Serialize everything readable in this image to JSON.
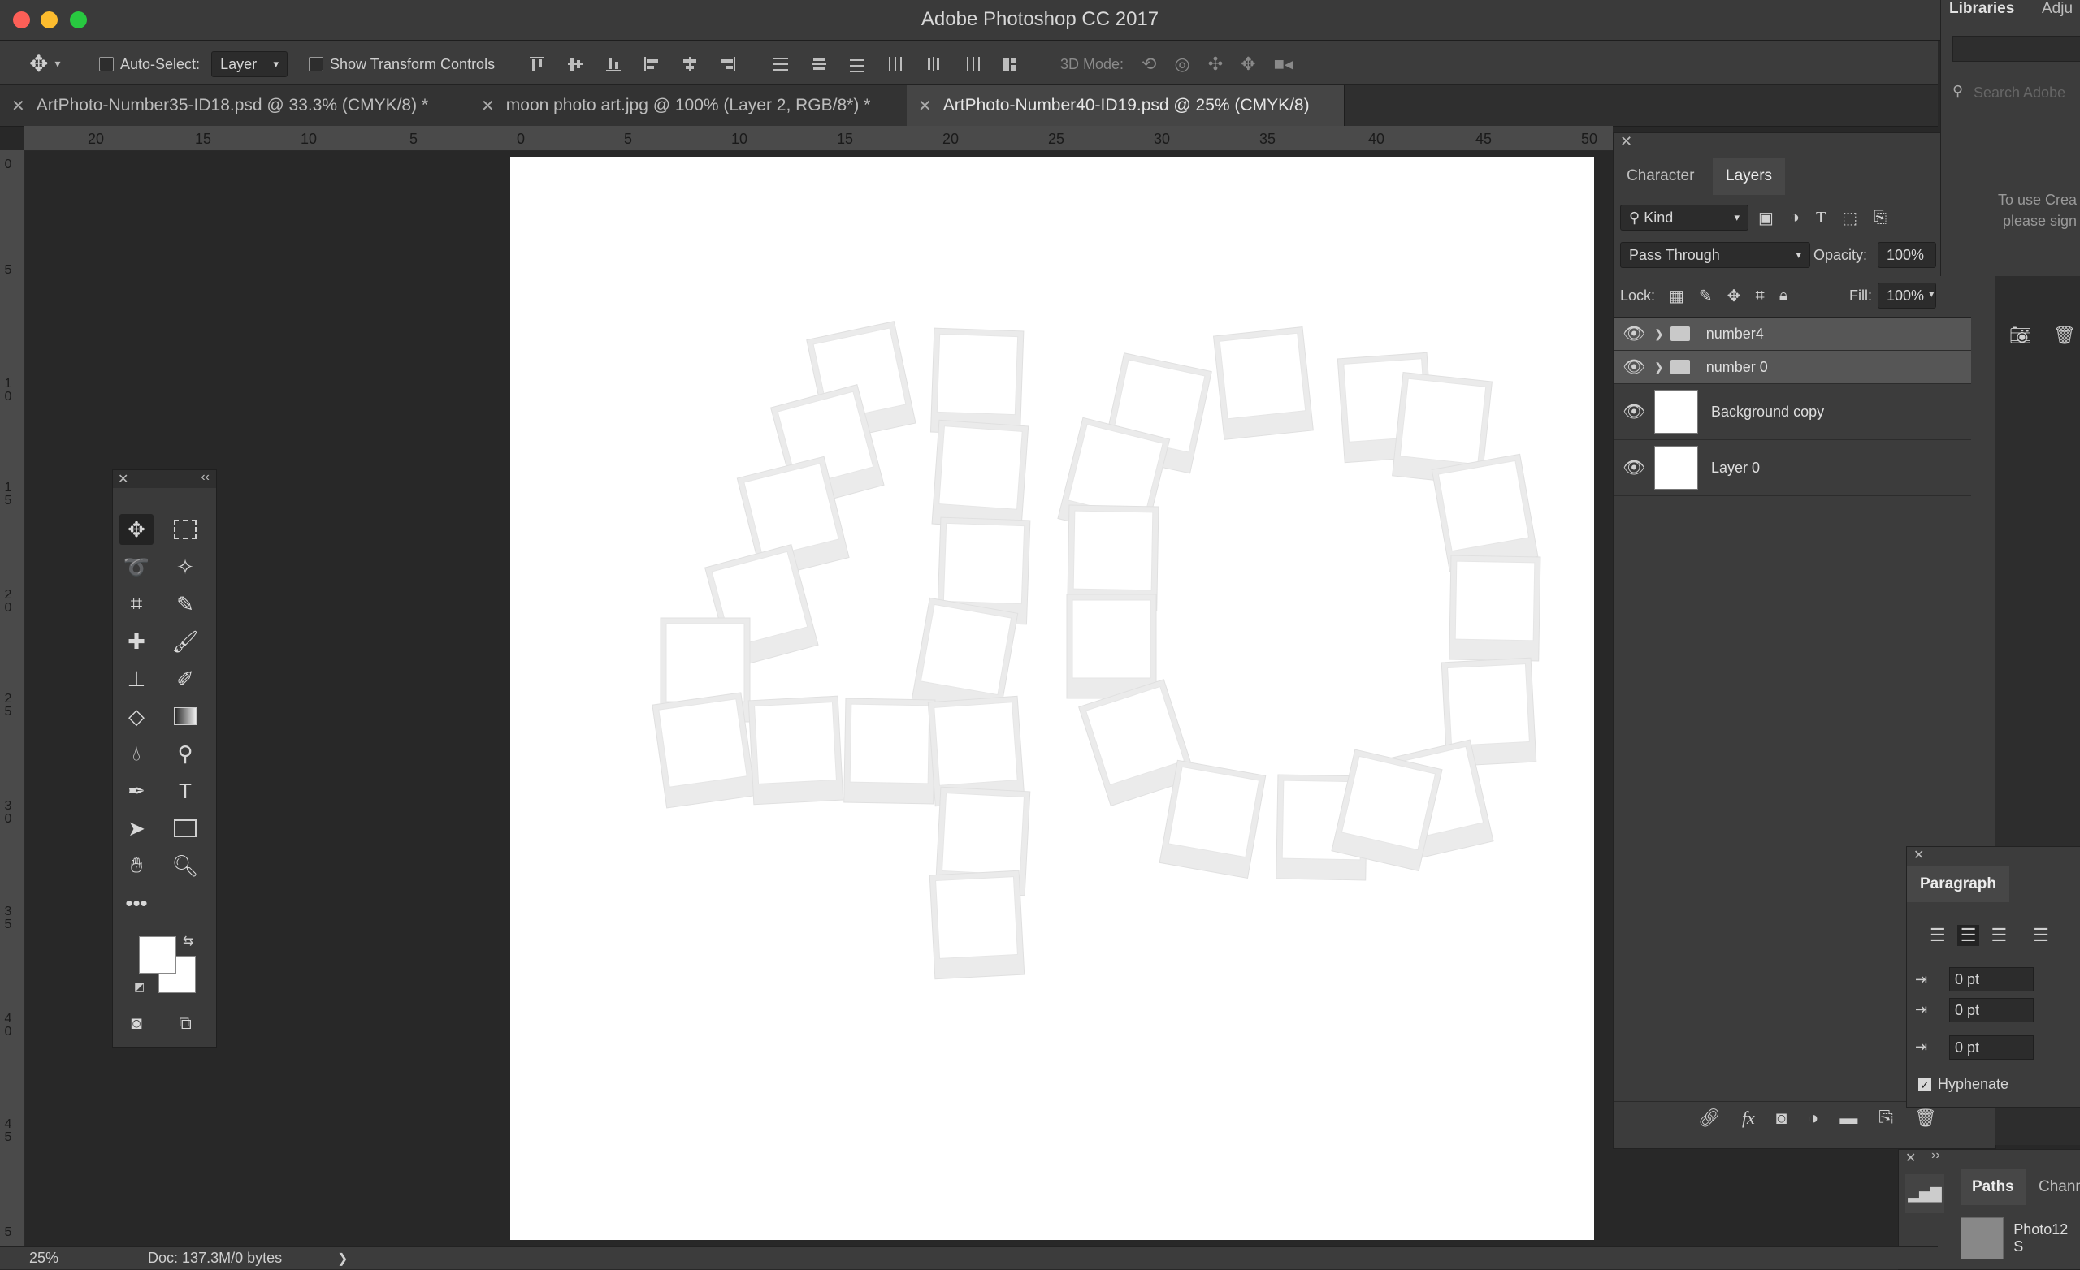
{
  "app": {
    "title": "Adobe Photoshop CC 2017"
  },
  "options_bar": {
    "auto_select_label": "Auto-Select:",
    "auto_select_value": "Layer",
    "show_transform_label": "Show Transform Controls",
    "mode_3d_label": "3D Mode:"
  },
  "tabs": [
    {
      "label": "ArtPhoto-Number35-ID18.psd @ 33.3% (CMYK/8) *",
      "active": false
    },
    {
      "label": "moon photo art.jpg @ 100% (Layer 2, RGB/8*) *",
      "active": false
    },
    {
      "label": "ArtPhoto-Number40-ID19.psd @ 25% (CMYK/8)",
      "active": true
    }
  ],
  "ruler_top_labels": [
    "20",
    "15",
    "10",
    "5",
    "0",
    "5",
    "10",
    "15",
    "20",
    "25",
    "30",
    "35",
    "40",
    "45",
    "50"
  ],
  "ruler_left_labels": [
    "0",
    "5",
    "1 0",
    "1 5",
    "2 0",
    "2 5",
    "3 0",
    "3 5",
    "4 0",
    "4 5",
    "5"
  ],
  "layers_panel": {
    "tabs": [
      "Character",
      "Layers"
    ],
    "active_tab": "Layers",
    "filter_kind": "Kind",
    "blend_mode": "Pass Through",
    "opacity_label": "Opacity:",
    "opacity_value": "100%",
    "lock_label": "Lock:",
    "fill_label": "Fill:",
    "fill_value": "100%",
    "layers": [
      {
        "name": "number4",
        "type": "group",
        "selected": true
      },
      {
        "name": "number 0",
        "type": "group",
        "selected": true
      },
      {
        "name": "Background copy",
        "type": "layer",
        "selected": false
      },
      {
        "name": "Layer 0",
        "type": "layer",
        "selected": false
      }
    ]
  },
  "libraries_panel": {
    "tabs": [
      "Libraries",
      "Adju"
    ],
    "search_placeholder": "Search Adobe",
    "message_line1": "To use Crea",
    "message_line2": "please sign"
  },
  "paragraph_panel": {
    "title": "Paragraph",
    "indent_left": "0 pt",
    "indent_first": "0 pt",
    "space_before": "0 pt",
    "hyphenate_label": "Hyphenate",
    "hyphenate_checked": true
  },
  "paths_panel": {
    "tabs": [
      "Paths",
      "Chann"
    ],
    "item_label": "Photo12 S"
  },
  "status_bar": {
    "zoom": "25%",
    "doc_info": "Doc: 137.3M/0 bytes",
    "arrow": "❯"
  },
  "colors": {
    "foreground": "#ffffff",
    "background": "#ffffff",
    "accent": "#4a90e2"
  }
}
